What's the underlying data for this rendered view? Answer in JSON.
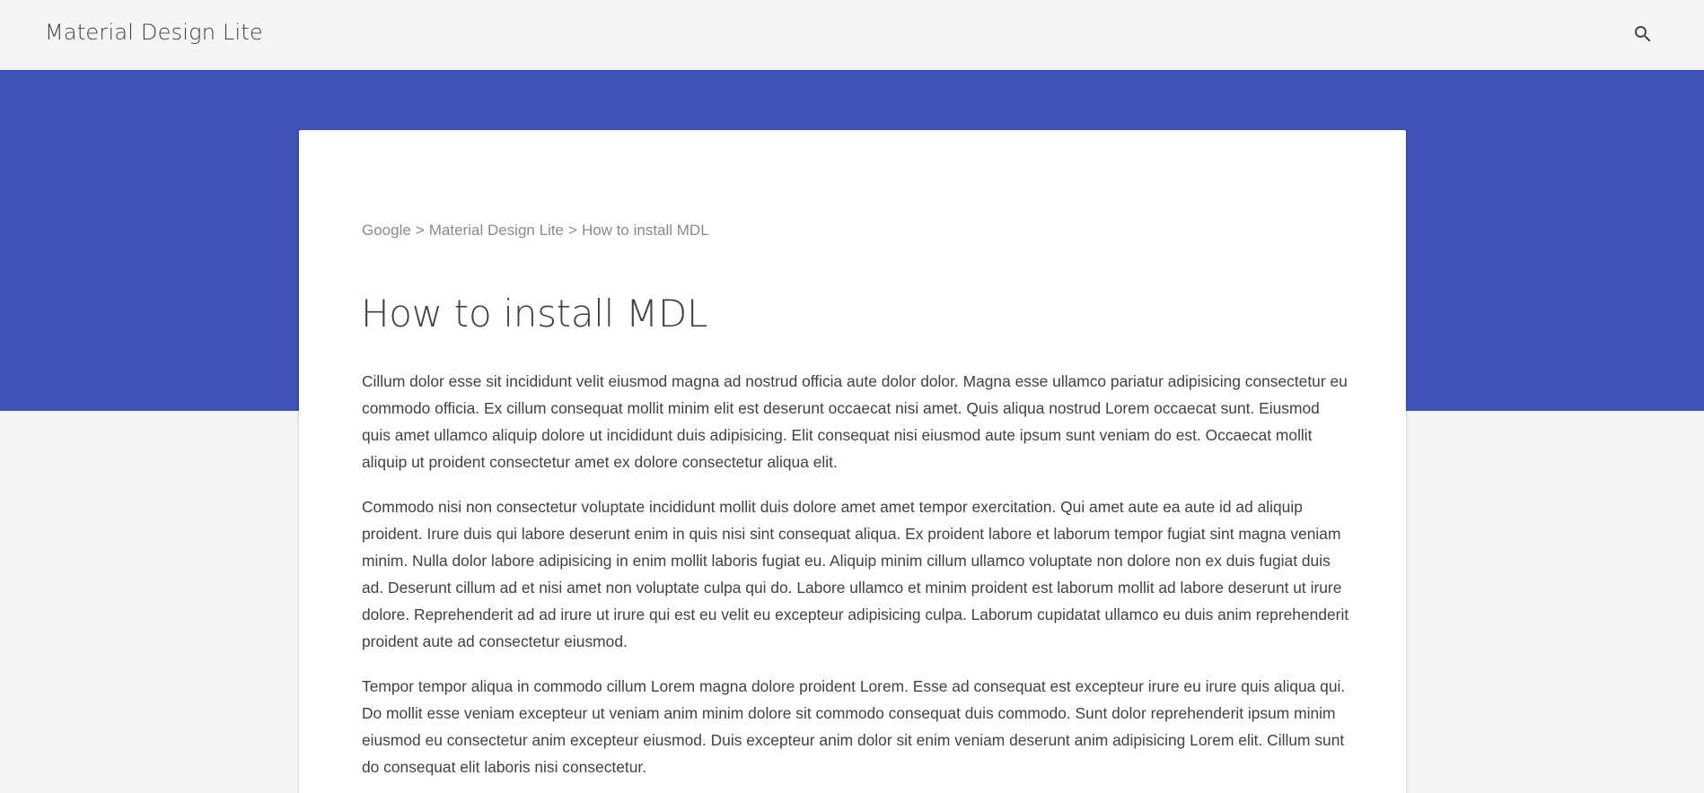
{
  "header": {
    "title": "Material Design Lite",
    "search_icon": "search-icon"
  },
  "colors": {
    "hero": "#3f51b5",
    "header_bg": "#f5f5f5",
    "card_bg": "#ffffff",
    "text": "#424242",
    "breadcrumb": "#8a8a8a"
  },
  "breadcrumb": {
    "items": [
      "Google",
      "Material Design Lite",
      "How to install MDL"
    ],
    "separator": ">"
  },
  "article": {
    "title": "How to install MDL",
    "paragraphs": [
      "Cillum dolor esse sit incididunt velit eiusmod magna ad nostrud officia aute dolor dolor. Magna esse ullamco pariatur adipisicing consectetur eu commodo officia. Ex cillum consequat mollit minim elit est deserunt occaecat nisi amet. Quis aliqua nostrud Lorem occaecat sunt. Eiusmod quis amet ullamco aliquip dolore ut incididunt duis adipisicing. Elit consequat nisi eiusmod aute ipsum sunt veniam do est. Occaecat mollit aliquip ut proident consectetur amet ex dolore consectetur aliqua elit.",
      "Commodo nisi non consectetur voluptate incididunt mollit duis dolore amet amet tempor exercitation. Qui amet aute ea aute id ad aliquip proident. Irure duis qui labore deserunt enim in quis nisi sint consequat aliqua. Ex proident labore et laborum tempor fugiat sint magna veniam minim. Nulla dolor labore adipisicing in enim mollit laboris fugiat eu. Aliquip minim cillum ullamco voluptate non dolore non ex duis fugiat duis ad. Deserunt cillum ad et nisi amet non voluptate culpa qui do. Labore ullamco et minim proident est laborum mollit ad labore deserunt ut irure dolore. Reprehenderit ad ad irure ut irure qui est eu velit eu excepteur adipisicing culpa. Laborum cupidatat ullamco eu duis anim reprehenderit proident aute ad consectetur eiusmod.",
      "Tempor tempor aliqua in commodo cillum Lorem magna dolore proident Lorem. Esse ad consequat est excepteur irure eu irure quis aliqua qui. Do mollit esse veniam excepteur ut veniam anim minim dolore sit commodo consequat duis commodo. Sunt dolor reprehenderit ipsum minim eiusmod eu consectetur anim excepteur eiusmod. Duis excepteur anim dolor sit enim veniam deserunt anim adipisicing Lorem elit. Cillum sunt do consequat elit laboris nisi consectetur."
    ]
  }
}
